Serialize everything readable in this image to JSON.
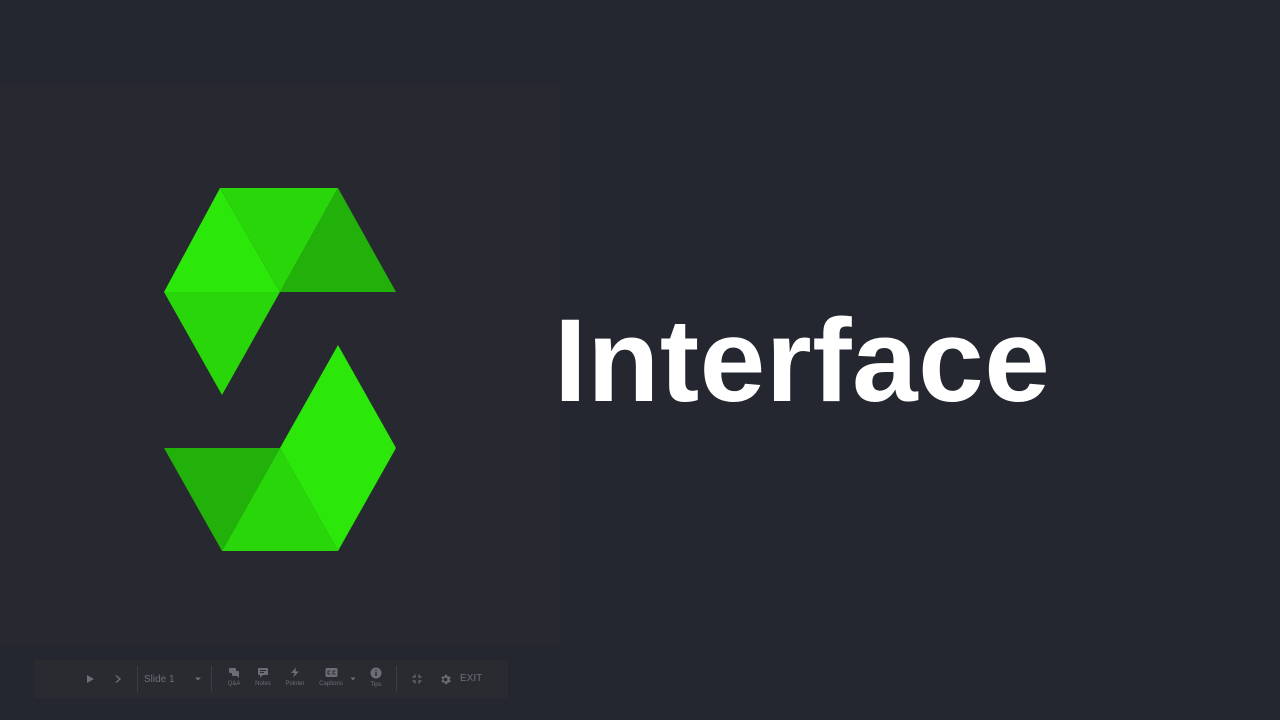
{
  "slide": {
    "title": "Interface"
  },
  "logo": {
    "colors": {
      "light": "#2be80a",
      "mid": "#28d60a",
      "dark": "#22b00a"
    }
  },
  "toolbar": {
    "play_icon": "play-icon",
    "next_icon": "chevron-right-icon",
    "slide_label": "Slide 1",
    "qa_label": "Q&A",
    "notes_label": "Notes",
    "pointer_label": "Pointer",
    "captions_label": "Captions",
    "captions_badge": "CC",
    "tips_label": "Tips",
    "exit_label": "EXIT"
  }
}
